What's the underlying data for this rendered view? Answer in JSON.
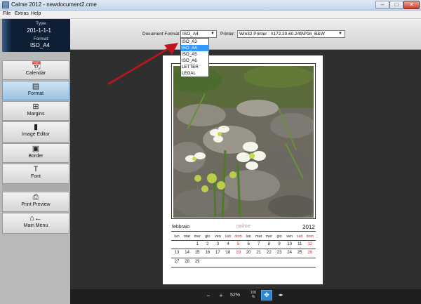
{
  "window": {
    "title": "Calme 2012 - newdocument2.cme"
  },
  "window_buttons": {
    "minimize": "–",
    "maximize": "□",
    "close": "✕"
  },
  "menu": [
    "File",
    "Extras",
    "Help"
  ],
  "info": {
    "type_label": "Type:",
    "type_value": "201-1-1-1",
    "format_label": "Format:",
    "format_value": "ISO_A4"
  },
  "nav": [
    {
      "label": "Calendar",
      "icon": "calendar-icon",
      "glyph": "📆"
    },
    {
      "label": "Format",
      "icon": "format-icon",
      "glyph": "▤",
      "active": true
    },
    {
      "label": "Margins",
      "icon": "margins-icon",
      "glyph": "⊞"
    },
    {
      "label": "Image Editor",
      "icon": "image-editor-icon",
      "glyph": "▮"
    },
    {
      "label": "Border",
      "icon": "border-icon",
      "glyph": "▣"
    },
    {
      "label": "Font",
      "icon": "font-icon",
      "glyph": "T"
    },
    {
      "label": "Print Preview",
      "icon": "printer-icon",
      "glyph": "⎙"
    },
    {
      "label": "Main Menu",
      "icon": "home-back-icon",
      "glyph": "⌂←"
    }
  ],
  "toolbar": {
    "format_label": "Document Format:",
    "format_value": "ISO_A4",
    "printer_label": "Printer:",
    "printer_value": "Win32 Printer : \\\\172.20.60.249\\P16_B&W"
  },
  "format_options": [
    "ISO_A3",
    "ISO_A4",
    "ISO_A5",
    "ISO_A6",
    "LETTER",
    "LEGAL"
  ],
  "format_selected_index": 1,
  "calendar": {
    "month": "febbraio",
    "brand": "calme",
    "year": "2012",
    "weekdays": [
      "lun",
      "mar",
      "mer",
      "gio",
      "ven",
      "sab",
      "dom",
      "lun",
      "mar",
      "mer",
      "gio",
      "ven",
      "sab",
      "dom"
    ],
    "rows": [
      [
        "",
        "",
        "1",
        "2",
        "3",
        "4",
        "5",
        "6",
        "7",
        "8",
        "9",
        "10",
        "11",
        "12"
      ],
      [
        "13",
        "14",
        "15",
        "16",
        "17",
        "18",
        "19",
        "20",
        "21",
        "22",
        "23",
        "24",
        "25",
        "26"
      ],
      [
        "27",
        "28",
        "29",
        "",
        "",
        "",
        "",
        "",
        "",
        "",
        "",
        "",
        "",
        ""
      ]
    ]
  },
  "zoom": {
    "value": "52%",
    "fit100_line1": "100",
    "fit100_line2": "%",
    "zoom_out": "−",
    "zoom_in": "+",
    "fit_page": "✥",
    "fit_width": "◂▸"
  },
  "colors": {
    "accent": "#3399ff",
    "sunday_red": "#c0303a",
    "info_bg": "#0e1e34"
  }
}
